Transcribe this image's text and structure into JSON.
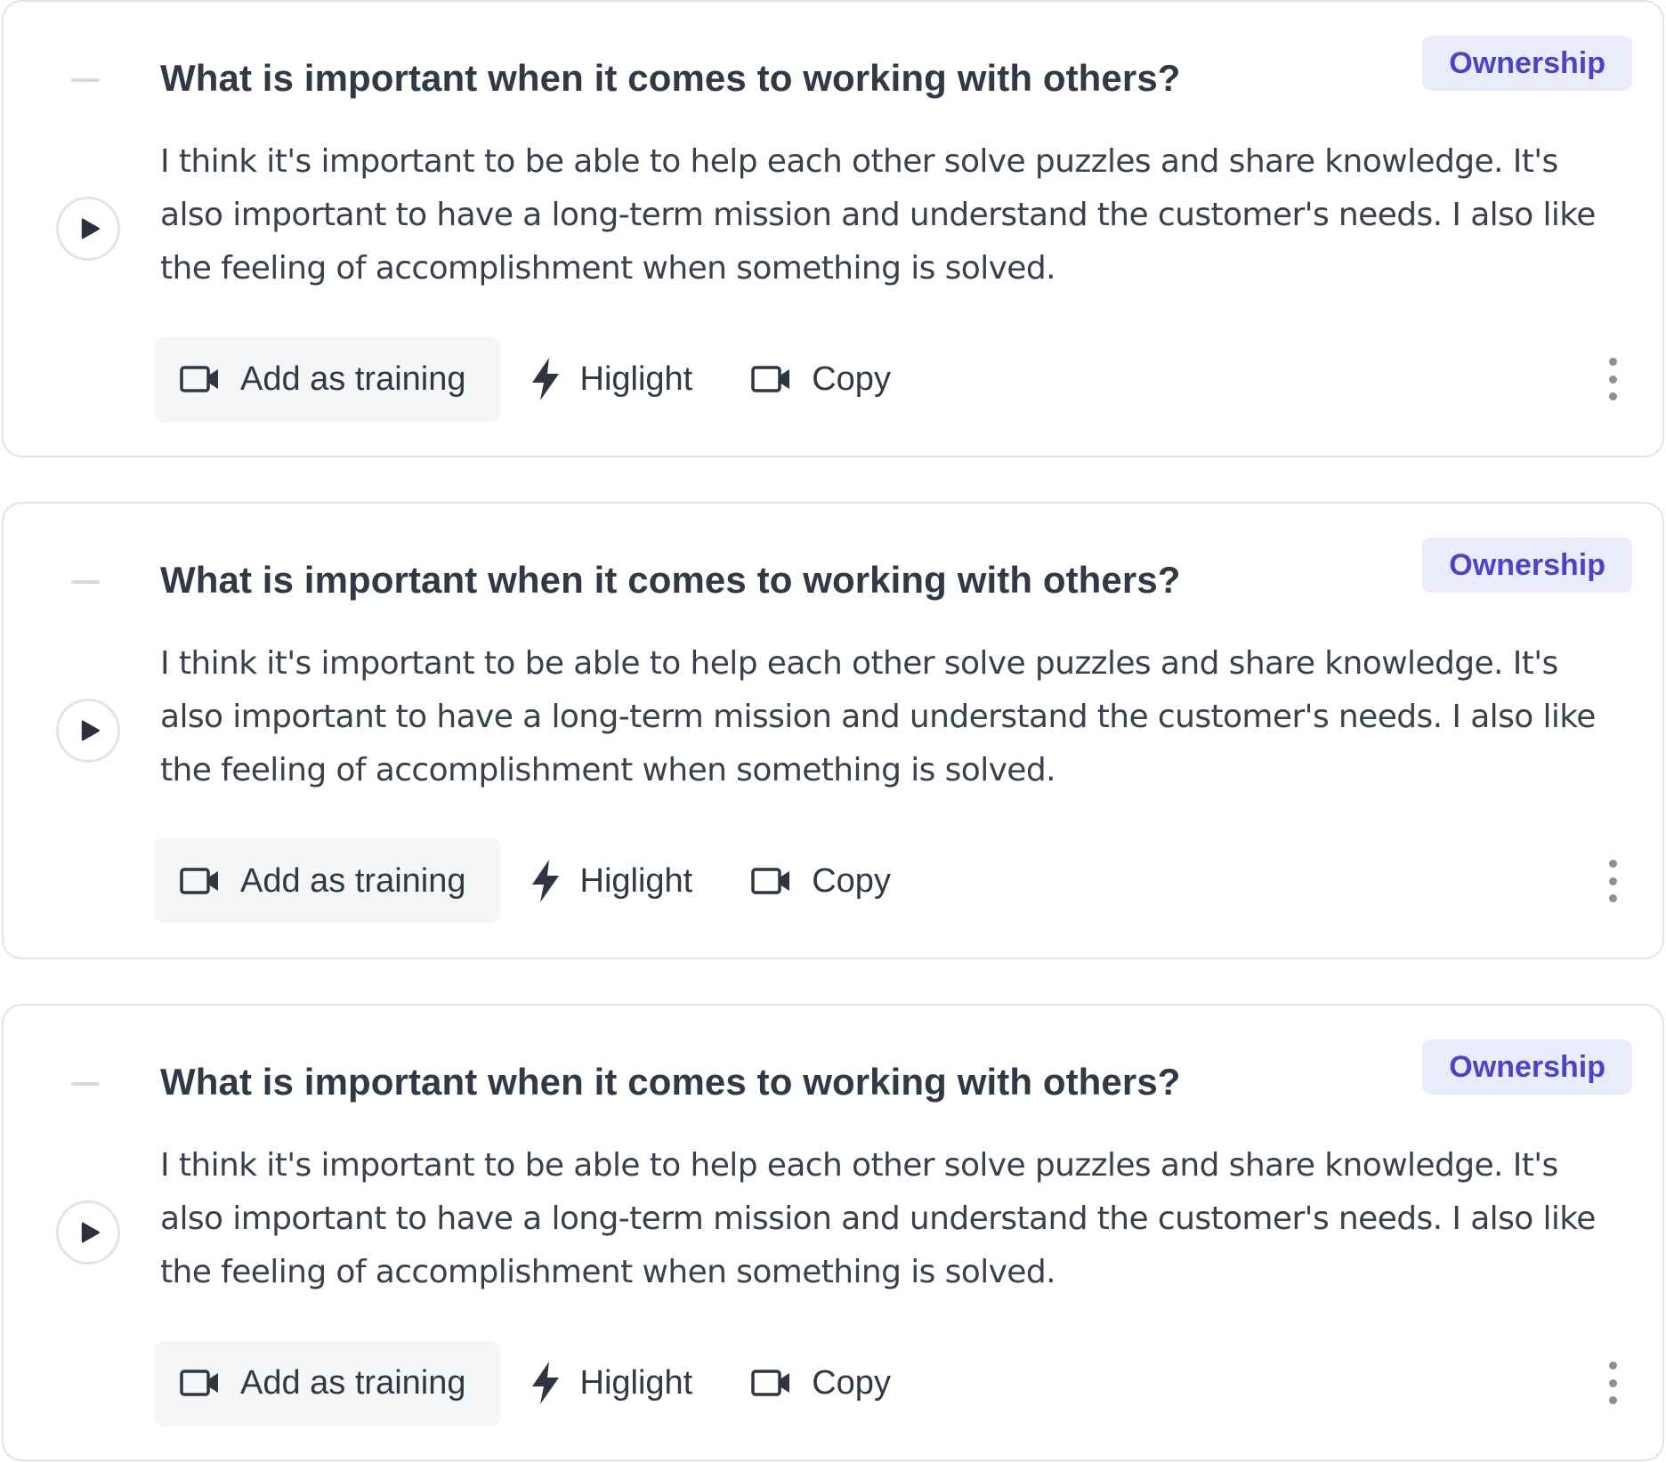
{
  "colors": {
    "tag_background": "#eaecfc",
    "tag_text": "#4b45c6",
    "card_border": "#dfe3ea",
    "text": "#323946"
  },
  "cards": [
    {
      "question": "What is important when it comes to working with others?",
      "tag": "Ownership",
      "answer": "I think it's important to be able to help each other solve puzzles and share knowledge. It's also important to have a long-term mission and understand the customer's needs. I also like the feeling of accomplishment when something is solved.",
      "actions": {
        "add_training": "Add as training",
        "highlight": "Higlight",
        "copy": "Copy"
      },
      "icons": {
        "play": "play-icon",
        "add_training": "video-camera-icon",
        "highlight": "lightning-icon",
        "copy": "video-camera-icon",
        "more": "more-vertical-icon"
      }
    },
    {
      "question": "What is important when it comes to working with others?",
      "tag": "Ownership",
      "answer": "I think it's important to be able to help each other solve puzzles and share knowledge. It's also important to have a long-term mission and understand the customer's needs. I also like the feeling of accomplishment when something is solved.",
      "actions": {
        "add_training": "Add as training",
        "highlight": "Higlight",
        "copy": "Copy"
      },
      "icons": {
        "play": "play-icon",
        "add_training": "video-camera-icon",
        "highlight": "lightning-icon",
        "copy": "video-camera-icon",
        "more": "more-vertical-icon"
      }
    },
    {
      "question": "What is important when it comes to working with others?",
      "tag": "Ownership",
      "answer": "I think it's important to be able to help each other solve puzzles and share knowledge. It's also important to have a long-term mission and understand the customer's needs. I also like the feeling of accomplishment when something is solved.",
      "actions": {
        "add_training": "Add as training",
        "highlight": "Higlight",
        "copy": "Copy"
      },
      "icons": {
        "play": "play-icon",
        "add_training": "video-camera-icon",
        "highlight": "lightning-icon",
        "copy": "video-camera-icon",
        "more": "more-vertical-icon"
      }
    }
  ]
}
